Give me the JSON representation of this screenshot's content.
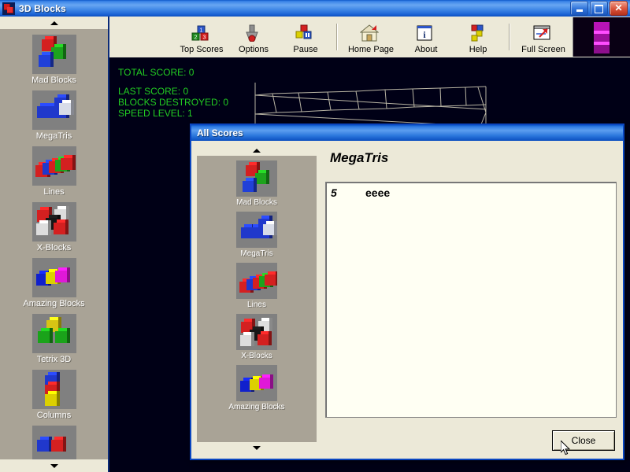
{
  "window": {
    "title": "3D Blocks",
    "icon": "app-blocks-icon",
    "buttons": {
      "minimize": "_",
      "maximize": "□",
      "close": "×"
    }
  },
  "toolbar": {
    "items": [
      {
        "label": "Top Scores",
        "icon": "blocks-123-icon"
      },
      {
        "label": "Options",
        "icon": "wrench-icon"
      },
      {
        "label": "Pause",
        "icon": "pause-blocks-icon"
      },
      {
        "label": "Home Page",
        "icon": "house-icon"
      },
      {
        "label": "About",
        "icon": "info-icon"
      },
      {
        "label": "Help",
        "icon": "help-blocks-icon"
      },
      {
        "label": "Full Screen",
        "icon": "fullscreen-icon"
      }
    ],
    "separator_after": [
      2,
      5
    ]
  },
  "sidebar": {
    "scroll_up": "▲",
    "scroll_down": "▼",
    "items": [
      {
        "label": "Mad Blocks"
      },
      {
        "label": "MegaTris"
      },
      {
        "label": "Lines"
      },
      {
        "label": "X-Blocks"
      },
      {
        "label": "Amazing Blocks"
      },
      {
        "label": "Tetrix 3D"
      },
      {
        "label": "Columns"
      },
      {
        "label": ""
      }
    ]
  },
  "game": {
    "total_score_label": "TOTAL SCORE: 0",
    "last_score_label": "LAST SCORE: 0",
    "blocks_destroyed_label": "BLOCKS DESTROYED: 0",
    "speed_level_label": "SPEED LEVEL: 1",
    "text_color": "#22cc22",
    "background_color": "#000016"
  },
  "dialog": {
    "title": "All Scores",
    "heading": "MegaTris",
    "close_label": "Close",
    "scroll_up": "▲",
    "scroll_down": "▼",
    "games": [
      {
        "label": "Mad Blocks"
      },
      {
        "label": "MegaTris"
      },
      {
        "label": "Lines"
      },
      {
        "label": "X-Blocks"
      },
      {
        "label": "Amazing Blocks"
      }
    ],
    "scores": [
      {
        "rank": "5",
        "name": "eeee"
      }
    ]
  }
}
